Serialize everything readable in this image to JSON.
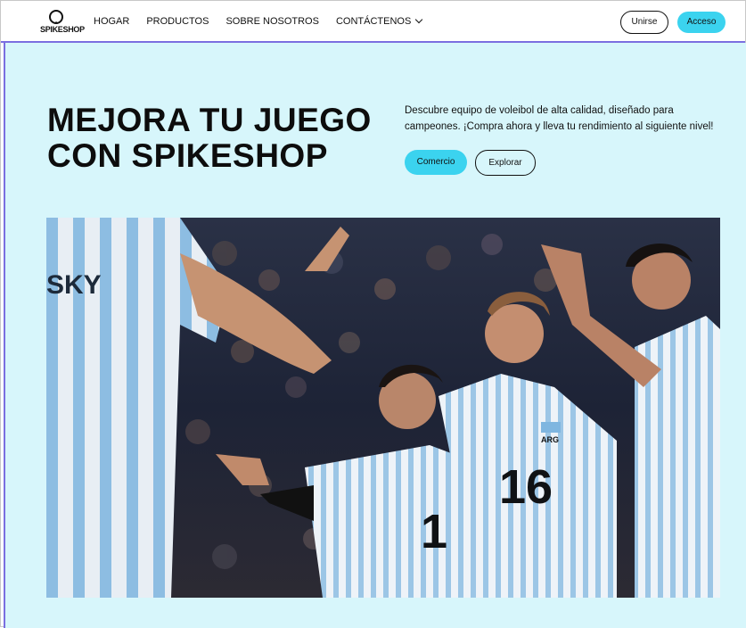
{
  "nav": {
    "logo_text": "SPIKESHOP",
    "items": [
      {
        "label": "HOGAR"
      },
      {
        "label": "PRODUCTOS"
      },
      {
        "label": "SOBRE NOSOTROS"
      },
      {
        "label": "CONTÁCTENOS"
      }
    ],
    "join_label": "Unirse",
    "access_label": "Acceso"
  },
  "hero": {
    "headline": "MEJORA TU JUEGO CON SPIKESHOP",
    "description": "Descubre equipo de voleibol de alta calidad, diseñado para campeones. ¡Compra ahora y lleva tu rendimiento al siguiente nivel!",
    "shop_label": "Comercio",
    "explore_label": "Explorar"
  },
  "photo": {
    "jersey_numbers": [
      "1",
      "16"
    ],
    "jersey_badge": "ARG",
    "back_text": "SKY"
  },
  "colors": {
    "accent": "#3bd3ef",
    "hero_bg": "#d7f6fb",
    "border": "#7b6fe0"
  }
}
